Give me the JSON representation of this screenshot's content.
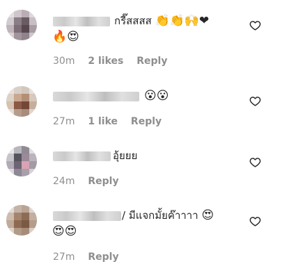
{
  "comments": [
    {
      "text": "กรี๊สสสส",
      "emojis": "👏👏🙌❤",
      "emojis_line2": "🔥😍",
      "time": "30m",
      "likes": "2 likes",
      "reply": "Reply"
    },
    {
      "text": "",
      "emojis": "😮😮",
      "emojis_line2": "",
      "time": "27m",
      "likes": "1 like",
      "reply": "Reply"
    },
    {
      "text": "อุ้ยยย",
      "emojis": "",
      "emojis_line2": "",
      "time": "24m",
      "likes": "",
      "reply": "Reply"
    },
    {
      "text": "/ มีแจกมั้ยค๊าาาา",
      "emojis": "😍",
      "emojis_line2": "😍😍",
      "time": "27m",
      "likes": "",
      "reply": "Reply"
    }
  ],
  "icons": {
    "like": "heart-outline-icon"
  },
  "colors": {
    "text": "#262626",
    "meta": "#8e8e8e",
    "background": "#ffffff"
  }
}
